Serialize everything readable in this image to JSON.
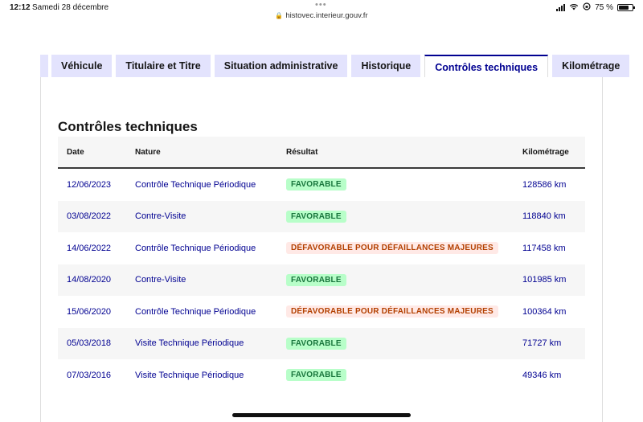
{
  "statusbar": {
    "time": "12:12",
    "date": "Samedi 28 décembre",
    "dots": "•••",
    "url": "histovec.interieur.gouv.fr",
    "battery": "75 %"
  },
  "tabs": [
    {
      "label": "Véhicule",
      "active": false
    },
    {
      "label": "Titulaire et Titre",
      "active": false
    },
    {
      "label": "Situation administrative",
      "active": false
    },
    {
      "label": "Historique",
      "active": false
    },
    {
      "label": "Contrôles techniques",
      "active": true
    },
    {
      "label": "Kilométrage",
      "active": false
    }
  ],
  "main": {
    "title": "Contrôles techniques",
    "columns": [
      "Date",
      "Nature",
      "Résultat",
      "Kilométrage"
    ],
    "rows": [
      {
        "date": "12/06/2023",
        "nature": "Contrôle Technique Périodique",
        "result": "FAVORABLE",
        "status": "fav",
        "km": "128586 km"
      },
      {
        "date": "03/08/2022",
        "nature": "Contre-Visite",
        "result": "FAVORABLE",
        "status": "fav",
        "km": "118840 km"
      },
      {
        "date": "14/06/2022",
        "nature": "Contrôle Technique Périodique",
        "result": "DÉFAVORABLE POUR DÉFAILLANCES MAJEURES",
        "status": "defav",
        "km": "117458 km"
      },
      {
        "date": "14/08/2020",
        "nature": "Contre-Visite",
        "result": "FAVORABLE",
        "status": "fav",
        "km": "101985 km"
      },
      {
        "date": "15/06/2020",
        "nature": "Contrôle Technique Périodique",
        "result": "DÉFAVORABLE POUR DÉFAILLANCES MAJEURES",
        "status": "defav",
        "km": "100364 km"
      },
      {
        "date": "05/03/2018",
        "nature": "Visite Technique Périodique",
        "result": "FAVORABLE",
        "status": "fav",
        "km": "71727 km"
      },
      {
        "date": "07/03/2016",
        "nature": "Visite Technique Périodique",
        "result": "FAVORABLE",
        "status": "fav",
        "km": "49346 km"
      }
    ]
  },
  "colors": {
    "accent": "#000091",
    "tab_bg": "#e3e3fd",
    "favorable_bg": "#b8fec9",
    "favorable_text": "#18753c",
    "defavorable_bg": "#ffe9e6",
    "defavorable_text": "#b34000"
  }
}
